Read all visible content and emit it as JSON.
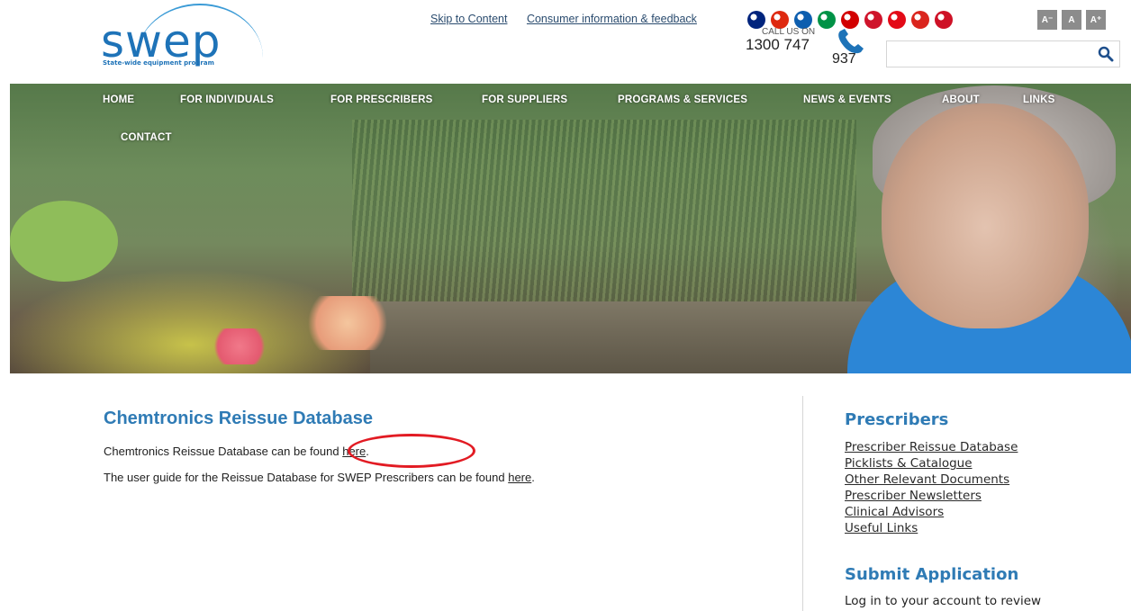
{
  "logo": {
    "word": "swep",
    "tagline": "State-wide equipment program"
  },
  "toplinks": {
    "skip": "Skip to Content",
    "consumer": "Consumer information & feedback"
  },
  "flags": [
    {
      "name": "australia-flag-icon",
      "color": "#00247d"
    },
    {
      "name": "china-flag-icon",
      "color": "#de2910"
    },
    {
      "name": "greece-flag-icon",
      "color": "#0d5eaf"
    },
    {
      "name": "italy-flag-icon",
      "color": "#009246"
    },
    {
      "name": "macedonia-flag-icon",
      "color": "#d20000"
    },
    {
      "name": "malta-flag-icon",
      "color": "#cf142b"
    },
    {
      "name": "turkey-flag-icon",
      "color": "#e30a17"
    },
    {
      "name": "vietnam-flag-icon",
      "color": "#da251d"
    },
    {
      "name": "egypt-flag-icon",
      "color": "#ce1126"
    }
  ],
  "font_size": {
    "smaller": "A⁻",
    "normal": "A",
    "larger": "A⁺"
  },
  "call": {
    "label": "CALL US ON",
    "number_part1": "1300 747",
    "number_part2": "937"
  },
  "search": {
    "placeholder": ""
  },
  "nav": {
    "row1": [
      "HOME",
      "FOR INDIVIDUALS",
      "FOR PRESCRIBERS",
      "FOR SUPPLIERS",
      "PROGRAMS & SERVICES",
      "NEWS & EVENTS",
      "ABOUT",
      "LINKS"
    ],
    "row2": [
      "CONTACT"
    ]
  },
  "main": {
    "title": "Chemtronics Reissue Database",
    "p1_before": "Chemtronics Reissue Database can be found ",
    "p1_link": "here",
    "p1_after": ".",
    "p2_before": "The user guide for the Reissue Database for SWEP Prescribers can be found ",
    "p2_link": "here",
    "p2_after": "."
  },
  "sidebar": {
    "prescribers_title": "Prescribers",
    "links": [
      "Prescriber Reissue Database",
      "Picklists & Catalogue",
      "Other Relevant Documents",
      "Prescriber Newsletters",
      "Clinical Advisors",
      "Useful Links"
    ],
    "submit_title": "Submit Application",
    "submit_text": "Log in to your account to review"
  },
  "colors": {
    "brand_blue": "#1e73b8",
    "heading_blue": "#2f7bb5",
    "annotation_red": "#e21b23"
  }
}
